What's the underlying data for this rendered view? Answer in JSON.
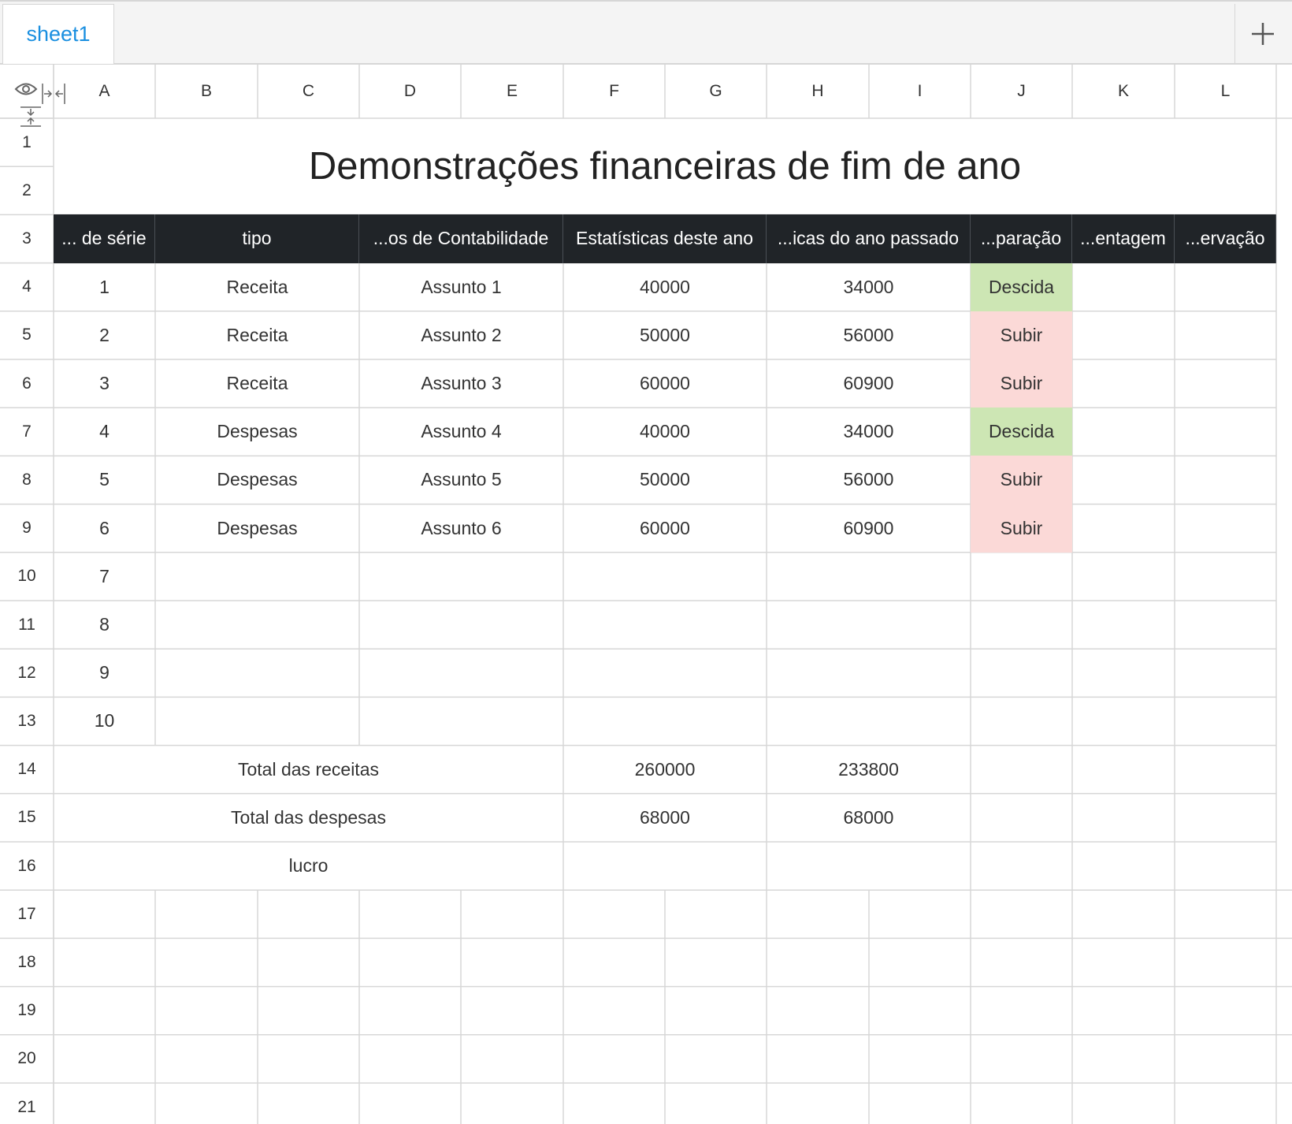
{
  "tabs": {
    "active": "sheet1",
    "add_icon": "plus-icon"
  },
  "columns": [
    "A",
    "B",
    "C",
    "D",
    "E",
    "F",
    "G",
    "H",
    "I",
    "J",
    "K",
    "L"
  ],
  "rows": [
    "1",
    "2",
    "3",
    "4",
    "5",
    "6",
    "7",
    "8",
    "9",
    "10",
    "11",
    "12",
    "13",
    "14",
    "15",
    "16",
    "17",
    "18",
    "19",
    "20",
    "21"
  ],
  "corner_icons": [
    "eye-icon",
    "collapse-columns-icon",
    "collapse-rows-icon"
  ],
  "sheet": {
    "title": "Demonstrações financeiras de fim de ano",
    "headers": {
      "serie": "... de série",
      "tipo": "tipo",
      "contabilidade": "...os de Contabilidade",
      "este_ano": "Estatísticas deste ano",
      "ano_passado": "...icas do ano passado",
      "comparacao": "...paração",
      "percentagem": "...entagem",
      "observacao": "...ervação"
    },
    "records": [
      {
        "serie": "1",
        "tipo": "Receita",
        "assunto": "Assunto 1",
        "este_ano": "40000",
        "ano_passado": "34000",
        "comparacao": "Descida"
      },
      {
        "serie": "2",
        "tipo": "Receita",
        "assunto": "Assunto 2",
        "este_ano": "50000",
        "ano_passado": "56000",
        "comparacao": "Subir"
      },
      {
        "serie": "3",
        "tipo": "Receita",
        "assunto": "Assunto 3",
        "este_ano": "60000",
        "ano_passado": "60900",
        "comparacao": "Subir"
      },
      {
        "serie": "4",
        "tipo": "Despesas",
        "assunto": "Assunto 4",
        "este_ano": "40000",
        "ano_passado": "34000",
        "comparacao": "Descida"
      },
      {
        "serie": "5",
        "tipo": "Despesas",
        "assunto": "Assunto 5",
        "este_ano": "50000",
        "ano_passado": "56000",
        "comparacao": "Subir"
      },
      {
        "serie": "6",
        "tipo": "Despesas",
        "assunto": "Assunto 6",
        "este_ano": "60000",
        "ano_passado": "60900",
        "comparacao": "Subir"
      }
    ],
    "empty_series": [
      "7",
      "8",
      "9",
      "10"
    ],
    "totals": [
      {
        "label": "Total das receitas",
        "este_ano": "260000",
        "ano_passado": "233800"
      },
      {
        "label": "Total das despesas",
        "este_ano": "68000",
        "ano_passado": "68000"
      },
      {
        "label": "lucro",
        "este_ano": "",
        "ano_passado": ""
      }
    ]
  },
  "colors": {
    "header_bg": "#202428",
    "descida_bg": "#cde6b4",
    "subir_bg": "#fbd9d7",
    "tab_text": "#1a8fe0"
  }
}
